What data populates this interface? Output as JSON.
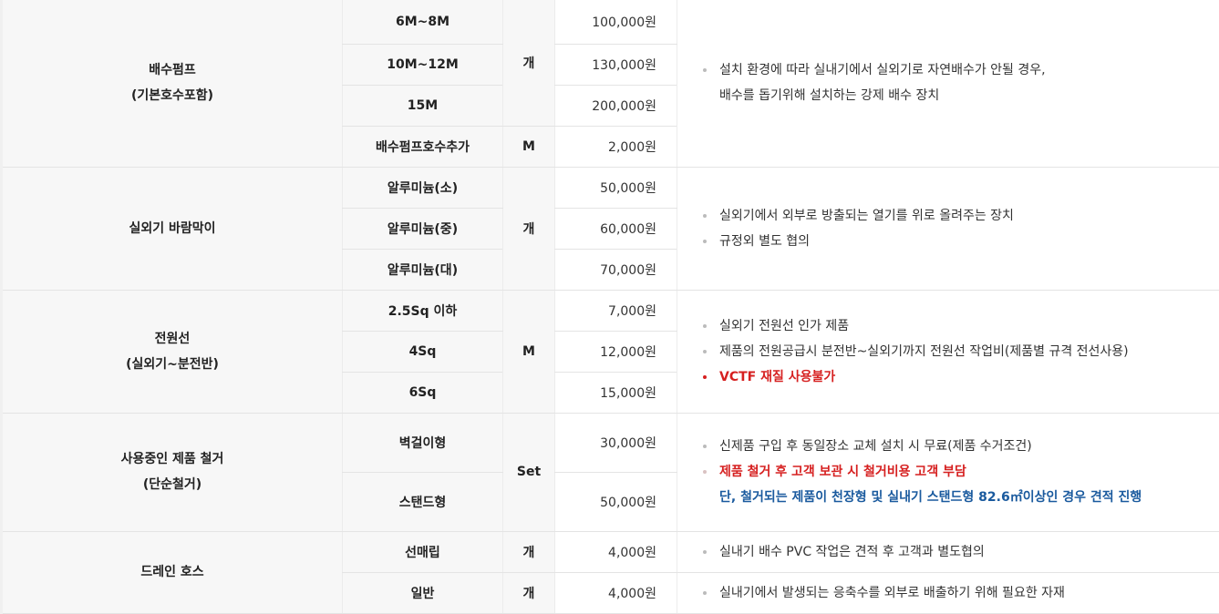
{
  "groups": [
    {
      "name_lines": [
        "배수펌프",
        "(기본호수포함)"
      ],
      "rows": [
        {
          "item": "6M~8M",
          "price": "100,000원"
        },
        {
          "item": "10M~12M",
          "price": "130,000원"
        },
        {
          "item": "15M",
          "price": "200,000원"
        },
        {
          "item": "배수펌프호수추가",
          "price": "2,000원"
        }
      ],
      "units": [
        "개",
        "M"
      ],
      "desc": [
        "설치 환경에 따라 실내기에서 실외기로 자연배수가 안될 경우,",
        "배수를 돕기위해 설치하는 강제 배수 장치"
      ]
    },
    {
      "name_lines": [
        "실외기 바람막이"
      ],
      "rows": [
        {
          "item": "알루미늄(소)",
          "price": "50,000원"
        },
        {
          "item": "알루미늄(중)",
          "price": "60,000원"
        },
        {
          "item": "알루미늄(대)",
          "price": "70,000원"
        }
      ],
      "units": [
        "개"
      ],
      "desc": [
        "실외기에서 외부로 방출되는 열기를 위로 올려주는 장치",
        "규정외 별도 협의"
      ]
    },
    {
      "name_lines": [
        "전원선",
        "(실외기~분전반)"
      ],
      "rows": [
        {
          "item": "2.5Sq 이하",
          "price": "7,000원"
        },
        {
          "item": "4Sq",
          "price": "12,000원"
        },
        {
          "item": "6Sq",
          "price": "15,000원"
        }
      ],
      "units": [
        "M"
      ],
      "desc": [
        "실외기 전원선 인가 제품",
        "제품의 전원공급시 분전반~실외기까지 전원선 작업비(제품별 규격 전선사용)",
        "VCTF 재질 사용불가"
      ]
    },
    {
      "name_lines": [
        "사용중인 제품 철거",
        "(단순철거)"
      ],
      "rows": [
        {
          "item": "벽걸이형",
          "price": "30,000원"
        },
        {
          "item": "스탠드형",
          "price": "50,000원"
        }
      ],
      "units": [
        "Set"
      ],
      "desc": [
        "신제품 구입 후 동일장소 교체 설치 시 무료(제품 수거조건)",
        "제품 철거 후 고객 보관 시 철거비용 고객 부담",
        "단, 철거되는 제품이 천장형 및 실내기 스탠드형 82.6㎡이상인 경우 견적 진행"
      ]
    },
    {
      "name_lines": [
        "드레인 호스"
      ],
      "rows": [
        {
          "item": "선매립",
          "price": "4,000원",
          "unit": "개",
          "desc": "실내기 배수 PVC 작업은 견적 후 고객과 별도협의"
        },
        {
          "item": "일반",
          "price": "4,000원",
          "unit": "개",
          "desc": "실내기에서 발생되는 응축수를 외부로 배출하기 위해 필요한 자재"
        }
      ]
    }
  ],
  "colors": {
    "red": "#d62020",
    "blue": "#1a5a9e",
    "header_bg": "#f7f7f7"
  }
}
